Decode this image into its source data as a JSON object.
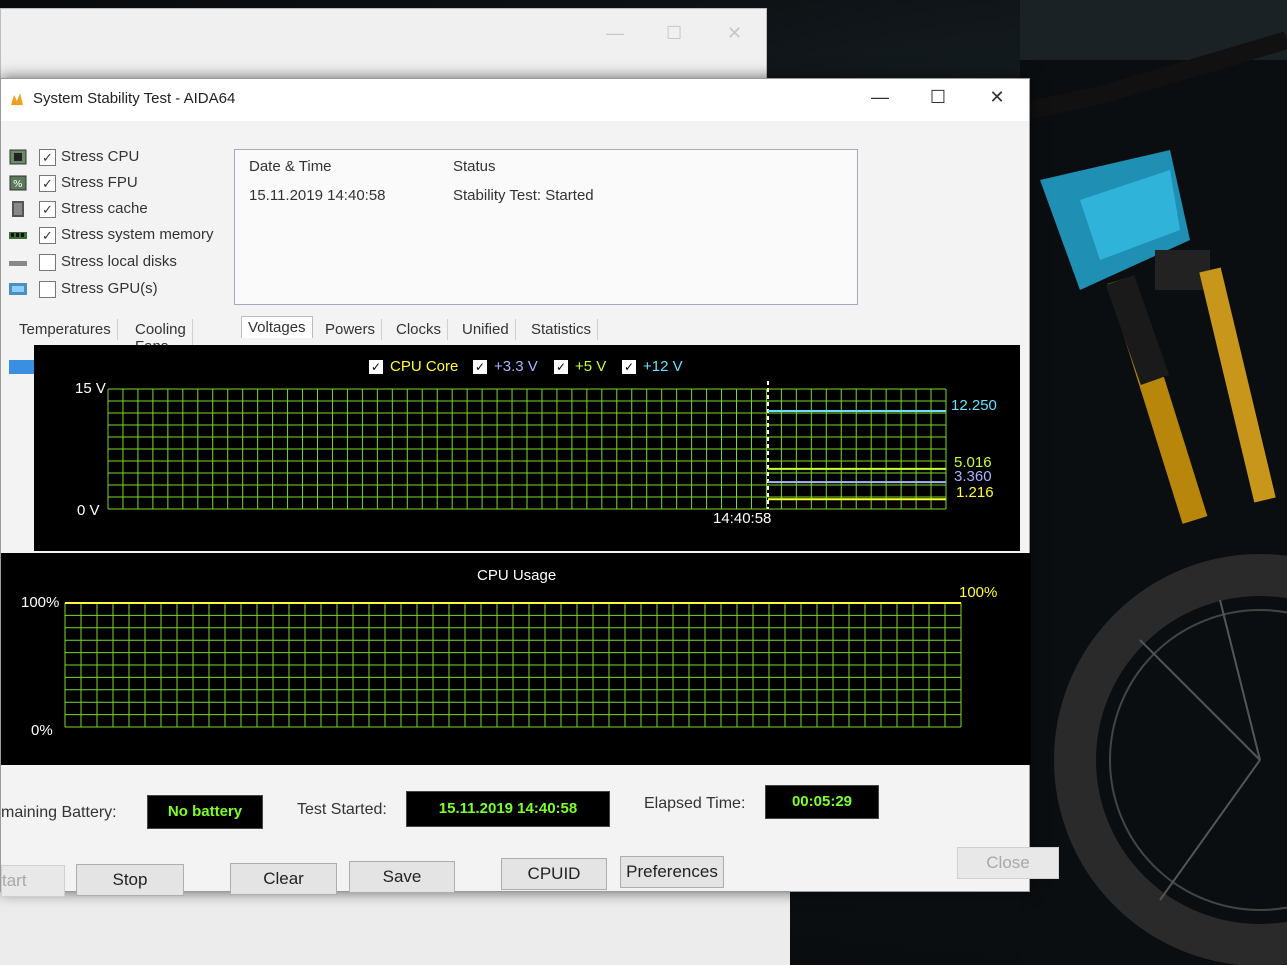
{
  "window": {
    "title": "System Stability Test - AIDA64",
    "minimize_glyph": "—",
    "maximize_glyph": "☐",
    "close_glyph": "✕"
  },
  "stress_options": [
    {
      "label": "Stress CPU",
      "checked": true,
      "icon": "cpu-icon"
    },
    {
      "label": "Stress FPU",
      "checked": true,
      "icon": "fpu-icon"
    },
    {
      "label": "Stress cache",
      "checked": true,
      "icon": "cache-icon"
    },
    {
      "label": "Stress system memory",
      "checked": true,
      "icon": "memory-icon"
    },
    {
      "label": "Stress local disks",
      "checked": false,
      "icon": "disk-icon"
    },
    {
      "label": "Stress GPU(s)",
      "checked": false,
      "icon": "gpu-icon"
    }
  ],
  "status_table": {
    "headers": [
      "Date & Time",
      "Status"
    ],
    "rows": [
      [
        "15.11.2019 14:40:58",
        "Stability Test: Started"
      ]
    ]
  },
  "tabs": [
    "Temperatures",
    "Cooling Fans",
    "Voltages",
    "Powers",
    "Clocks",
    "Unified",
    "Statistics"
  ],
  "active_tab": "Voltages",
  "voltage_graph": {
    "legend": [
      {
        "label": "CPU Core",
        "checked": true,
        "color": "#ffff33"
      },
      {
        "label": "+3.3 V",
        "checked": true,
        "color": "#a8b4ff"
      },
      {
        "label": "+5 V",
        "checked": true,
        "color": "#c8ff33"
      },
      {
        "label": "+12 V",
        "checked": true,
        "color": "#66e0ff"
      }
    ],
    "y_max_label": "15 V",
    "y_min_label": "0 V",
    "time_label": "14:40:58",
    "readouts": [
      {
        "text": "12.250",
        "color": "#66e0ff"
      },
      {
        "text": "5.016",
        "color": "#c8ff33"
      },
      {
        "text": "3.360",
        "color": "#a8b4ff"
      },
      {
        "text": "1.216",
        "color": "#ffff33"
      }
    ]
  },
  "usage_graph": {
    "title": "CPU Usage",
    "y_max_label": "100%",
    "y_min_label": "0%",
    "readout": "100%"
  },
  "chart_data": [
    {
      "type": "line",
      "title": "",
      "ylim": [
        0,
        15
      ],
      "yticks": [
        "15 V",
        "0 V"
      ],
      "x_labels": [
        "14:40:58"
      ],
      "series": [
        {
          "name": "CPU Core",
          "values": [
            1.216
          ]
        },
        {
          "name": "+3.3 V",
          "values": [
            3.36
          ]
        },
        {
          "name": "+5 V",
          "values": [
            5.016
          ]
        },
        {
          "name": "+12 V",
          "values": [
            12.25
          ]
        }
      ]
    },
    {
      "type": "line",
      "title": "CPU Usage",
      "ylim": [
        0,
        100
      ],
      "yticks": [
        "100%",
        "0%"
      ],
      "series": [
        {
          "name": "",
          "values": [
            100
          ]
        }
      ]
    }
  ],
  "footer": {
    "battery_label": "maining Battery:",
    "battery_value": "No battery",
    "test_started_label": "Test Started:",
    "test_started_value": "15.11.2019 14:40:58",
    "elapsed_label": "Elapsed Time:",
    "elapsed_value": "00:05:29"
  },
  "buttons": {
    "start": "tart",
    "stop": "Stop",
    "clear": "Clear",
    "save": "Save",
    "cpuid": "CPUID",
    "preferences": "Preferences",
    "close": "Close"
  }
}
